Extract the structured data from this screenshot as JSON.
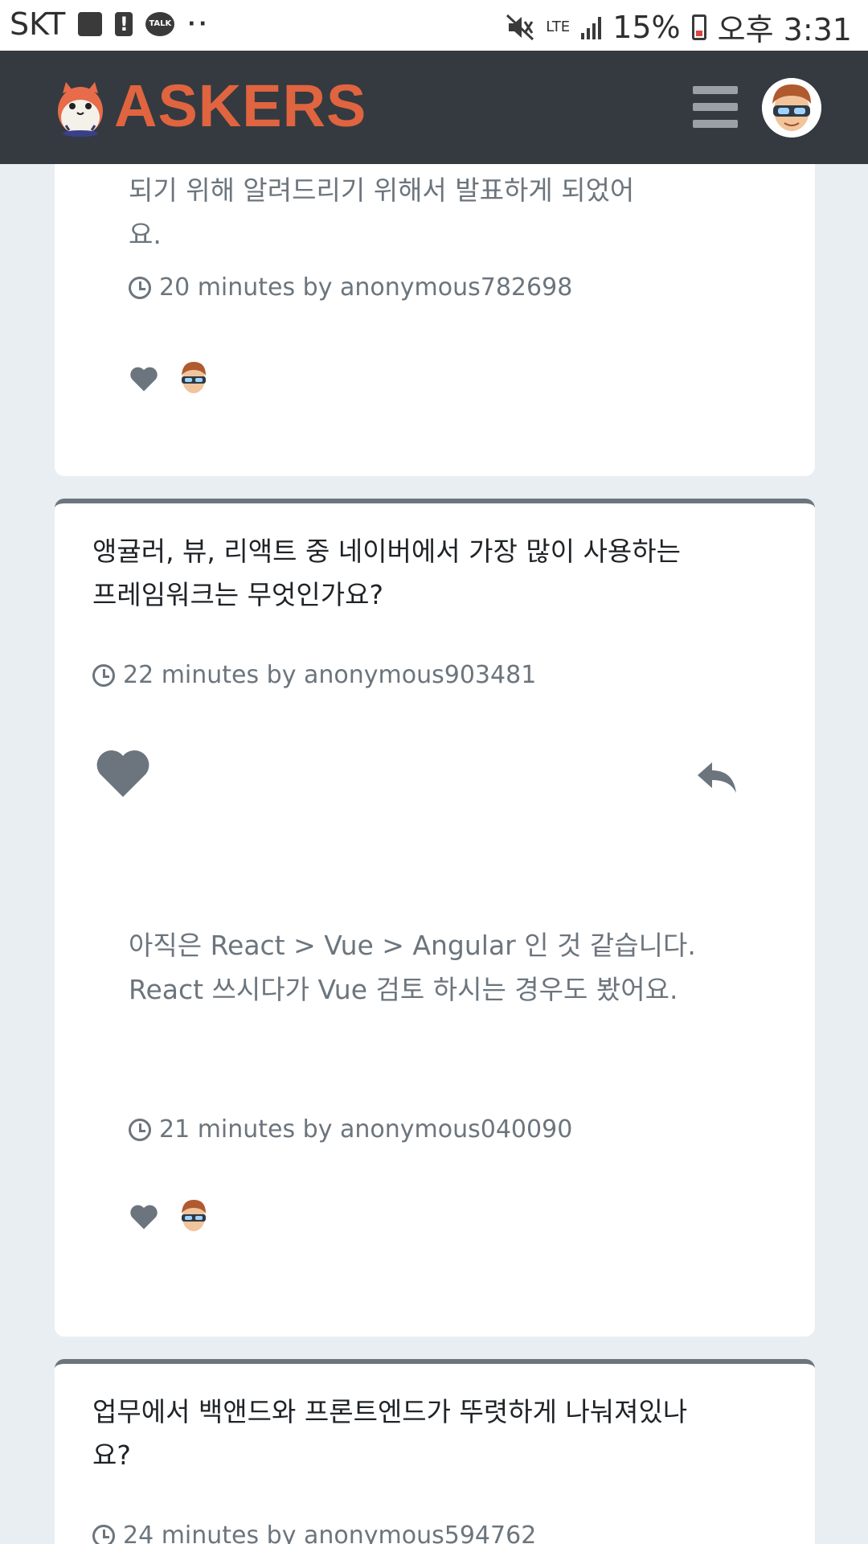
{
  "status_bar": {
    "carrier": "SKT",
    "network": "LTE",
    "battery_percent": "15%",
    "time": "오후 3:31",
    "talk_badge": "TALK"
  },
  "navbar": {
    "brand": "ASKERS",
    "icons": [
      "hamster-logo",
      "hamburger-menu-icon",
      "user-avatar"
    ]
  },
  "feed": {
    "card0": {
      "answer_partial_line": "되기 위해 알려드리기 위해서 발표하게 되었어",
      "answer_partial_tail": "요.",
      "answer_meta": "20 minutes by anonymous782698"
    },
    "card1": {
      "question": "앵귤러, 뷰, 리액트 중 네이버에서 가장 많이 사용하는 프레임워크는 무엇인가요?",
      "question_meta": "22 minutes by anonymous903481",
      "answer": "아직은 React > Vue > Angular 인 것 같습니다.\nReact 쓰시다가 Vue 검토 하시는 경우도 봤어요.",
      "answer_meta": "21 minutes by anonymous040090"
    },
    "card2": {
      "question": "업무에서 백앤드와 프론트엔드가 뚜렷하게 나눠져있나요?",
      "question_meta": "24 minutes by anonymous594762"
    }
  },
  "colors": {
    "navbar_bg": "#343a40",
    "brand": "#e0643f",
    "muted": "#6c757d",
    "page_bg": "#e9eef2"
  }
}
